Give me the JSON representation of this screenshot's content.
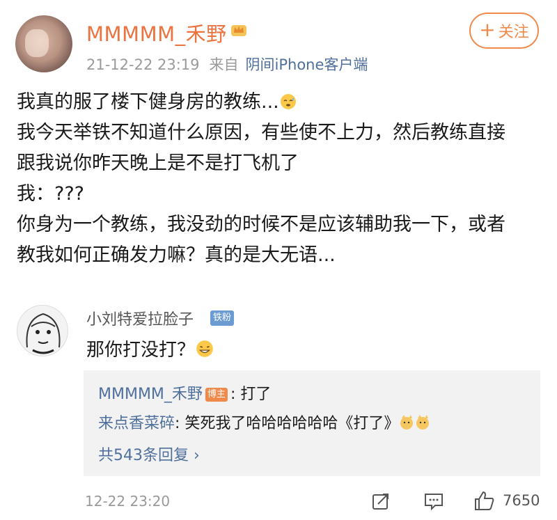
{
  "post": {
    "author": "MMMMM_禾野",
    "timestamp": "21-12-22 23:19",
    "source_prefix": "来自",
    "source": "阴间iPhone客户端",
    "follow_label": "关注",
    "lines": [
      "我真的服了楼下健身房的教练...",
      "我今天举铁不知道什么原因，有些使不上力，然后教练直接",
      "跟我说你昨天晚上是不是打飞机了",
      "我：???",
      "你身为一个教练，我没劲的时候不是应该辅助我一下，或者",
      "教我如何正确发力嘛？真的是大无语..."
    ]
  },
  "comment": {
    "author": "小刘特爱拉脸子",
    "fan_badge": "铁粉",
    "text": "那你打没打？",
    "timestamp": "12-22 23:20",
    "like_count": "7650",
    "replies": [
      {
        "author": "MMMMM_禾野",
        "badge": "博主",
        "text": ": 打了"
      },
      {
        "author": "来点香菜碎",
        "text": ": 笑死我了哈哈哈哈哈哈《打了》"
      }
    ],
    "more_replies": "共543条回复"
  },
  "colors": {
    "accent": "#eb7340",
    "link": "#4f6f9d"
  }
}
